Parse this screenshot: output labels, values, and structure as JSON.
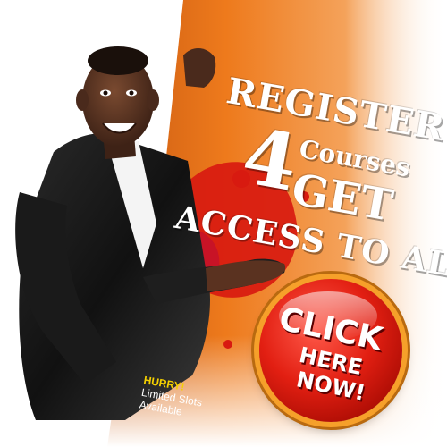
{
  "banner": {
    "headline_register": "REGISTER",
    "headline_number": "4",
    "headline_courses": "Courses",
    "headline_get": "GET",
    "headline_access": "ACCESS TO ALL",
    "click_button": {
      "line1": "CLICK",
      "line2": "HERE",
      "line3": "NOW!"
    },
    "hurry": {
      "title": "HURRY!",
      "line1": "Limited Slots",
      "line2": "Available"
    }
  },
  "colors": {
    "panel_orange": "#ee7a1c",
    "splash_red": "#d81a10",
    "splash_purple": "#8b2fa0",
    "button_red": "#e21f12",
    "button_ring": "#f6a02a",
    "hurry_yellow": "#f4d000"
  }
}
